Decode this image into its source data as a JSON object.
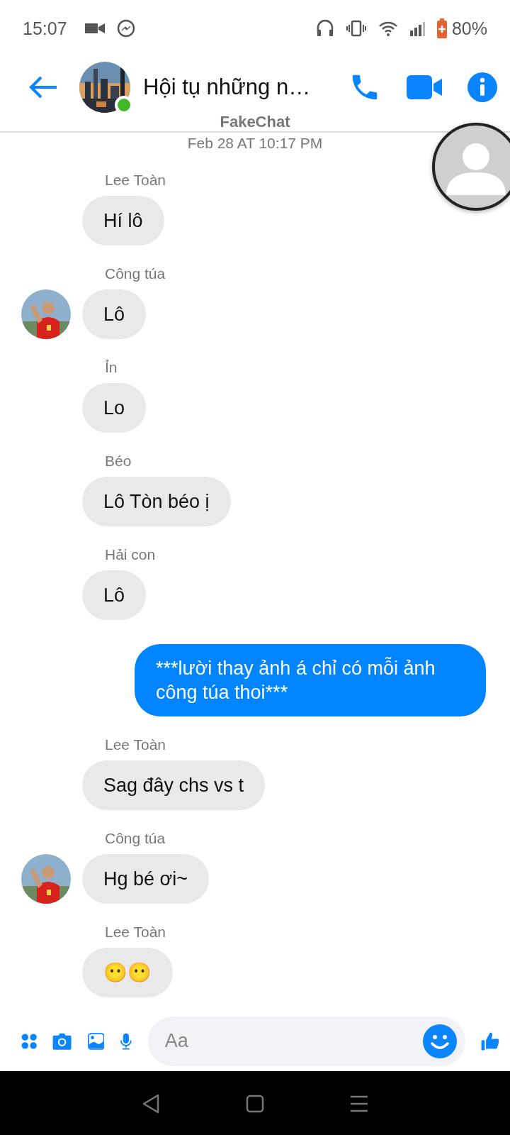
{
  "status_bar": {
    "time": "15:07",
    "battery": "80%"
  },
  "header": {
    "title": "Hội tụ những n…",
    "online": true,
    "subtitle": "FakeChat"
  },
  "date": "Feb 28 AT 10:17 PM",
  "messages": [
    {
      "kind": "incoming",
      "sender": "Lee Toàn",
      "text": "Hí lô",
      "avatar": false
    },
    {
      "kind": "incoming",
      "sender": "Công túa",
      "text": "Lô",
      "avatar": true
    },
    {
      "kind": "incoming",
      "sender": "Ỉn",
      "text": "Lo",
      "avatar": false
    },
    {
      "kind": "incoming",
      "sender": "Béo",
      "text": "Lô Tòn béo ị",
      "avatar": false
    },
    {
      "kind": "incoming",
      "sender": "Hải con",
      "text": "Lô",
      "avatar": false
    },
    {
      "kind": "outgoing",
      "text": "***lười thay ảnh á chỉ có mỗi ảnh công túa thoi***"
    },
    {
      "kind": "incoming",
      "sender": "Lee Toàn",
      "text": "Sag đây chs vs t",
      "avatar": false
    },
    {
      "kind": "incoming",
      "sender": "Công túa",
      "text": "Hg bé ơi~",
      "avatar": true
    },
    {
      "kind": "incoming",
      "sender": "Lee Toàn",
      "text": "😶😶",
      "avatar": false
    }
  ],
  "composer": {
    "placeholder": "Aa"
  }
}
